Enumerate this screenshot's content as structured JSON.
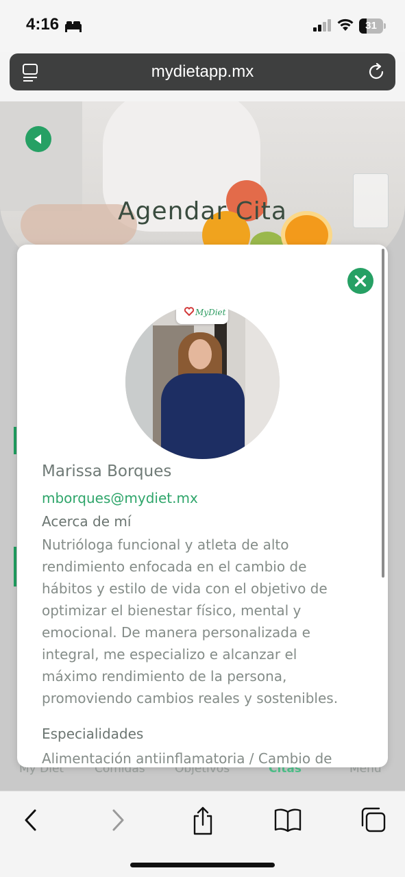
{
  "status_bar": {
    "time": "4:16",
    "battery_percent": 31,
    "battery_label": "31"
  },
  "browser": {
    "url": "mydietapp.mx"
  },
  "page": {
    "title": "Agendar Cita",
    "bottom_nav": [
      {
        "label": "My Diet"
      },
      {
        "label": "Comidas"
      },
      {
        "label": "Objetivos"
      },
      {
        "label": "Citas",
        "active": true
      },
      {
        "label": "Menú"
      }
    ]
  },
  "modal": {
    "logo_text": "MyDiet",
    "name": "Marissa Borques",
    "email": "mborques@mydiet.mx",
    "about_heading": "Acerca de mí",
    "about_lines": [
      "Nutrióloga funcional y atleta de alto",
      "rendimiento enfocada en el cambio de",
      "hábitos y estilo de vida con el objetivo de",
      "optimizar el bienestar físico, mental y",
      "emocional. De manera personalizada e",
      "integral, me especializo e alcanzar el",
      "máximo rendimiento de la persona,",
      "promoviendo cambios reales y sostenibles."
    ],
    "specialties_heading": "Especialidades",
    "specialties_text": "Alimentación antiinflamatoria / Cambio de"
  },
  "colors": {
    "accent": "#26a064",
    "email": "#2ea56a",
    "url_bar": "#3e3f3f"
  }
}
